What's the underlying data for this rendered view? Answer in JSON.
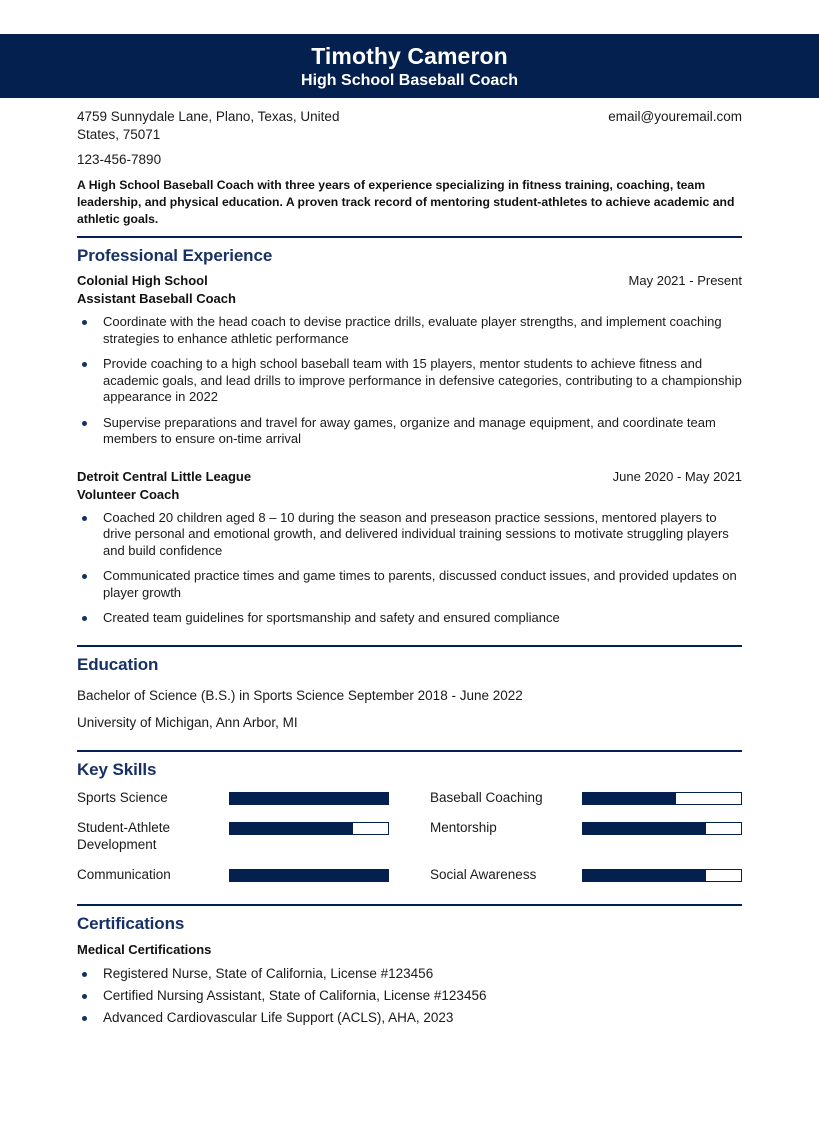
{
  "theme": {
    "navy": "#04204f",
    "heading_blue": "#173066",
    "bullet_navy": "#123163",
    "text": "#1a1a1a",
    "page_bg": "#ffffff"
  },
  "header": {
    "name": "Timothy Cameron",
    "job_title": "High School Baseball Coach"
  },
  "contact": {
    "address_line1": "4759 Sunnydale Lane, Plano, Texas, United",
    "address_line2": "States, 75071",
    "phone": "123-456-7890",
    "email": "email@youremail.com"
  },
  "summary": {
    "text": "A High School Baseball Coach with three years of experience specializing in fitness training, coaching, team leadership, and physical education. A proven track record of mentoring student-athletes to achieve academic and athletic goals."
  },
  "sections": {
    "experience": {
      "title": "Professional Experience",
      "jobs": [
        {
          "organization": "Colonial High School",
          "dates": "May 2021 - Present",
          "role": "Assistant Baseball Coach",
          "bullets": [
            "Coordinate with the head coach to devise practice drills, evaluate player strengths, and implement coaching strategies to enhance athletic performance",
            "Provide coaching to a high school baseball team with 15 players, mentor students to achieve fitness and academic goals, and lead drills to improve performance in defensive categories, contributing to a championship appearance in 2022",
            "Supervise preparations and travel for away games, organize and manage equipment, and coordinate team members to ensure on-time arrival"
          ]
        },
        {
          "organization": "Detroit Central Little League",
          "dates": "June 2020 - May 2021",
          "role": "Volunteer Coach",
          "bullets": [
            "Coached 20 children aged 8 – 10 during the season and preseason practice sessions, mentored players to drive personal and emotional growth, and delivered individual training sessions to motivate struggling players and build confidence",
            "Communicated practice times and game times to parents, discussed conduct issues, and provided updates on player growth",
            "Created team guidelines for sportsmanship and safety and ensured compliance"
          ]
        }
      ]
    },
    "education": {
      "title": "Education",
      "entries": [
        "Bachelor of Science (B.S.) in Sports Science September 2018 - June 2022",
        "University of Michigan, Ann Arbor, MI"
      ]
    },
    "key_skills": {
      "title": "Key Skills",
      "items": [
        {
          "label": "Sports Science",
          "level": 100,
          "column": "left"
        },
        {
          "label": "Baseball Coaching",
          "level": 59,
          "column": "right"
        },
        {
          "label": "Student-Athlete Development",
          "level": 78,
          "column": "left"
        },
        {
          "label": "Mentorship",
          "level": 78,
          "column": "right"
        },
        {
          "label": "Communication",
          "level": 100,
          "column": "left"
        },
        {
          "label": "Social Awareness",
          "level": 78,
          "column": "right"
        }
      ]
    },
    "certifications": {
      "title": "Certifications",
      "subheading": "Medical Certifications",
      "items": [
        "Registered Nurse, State of California, License #123456",
        "Certified Nursing Assistant, State of California, License #123456",
        "Advanced Cardiovascular Life Support (ACLS), AHA, 2023"
      ]
    }
  }
}
